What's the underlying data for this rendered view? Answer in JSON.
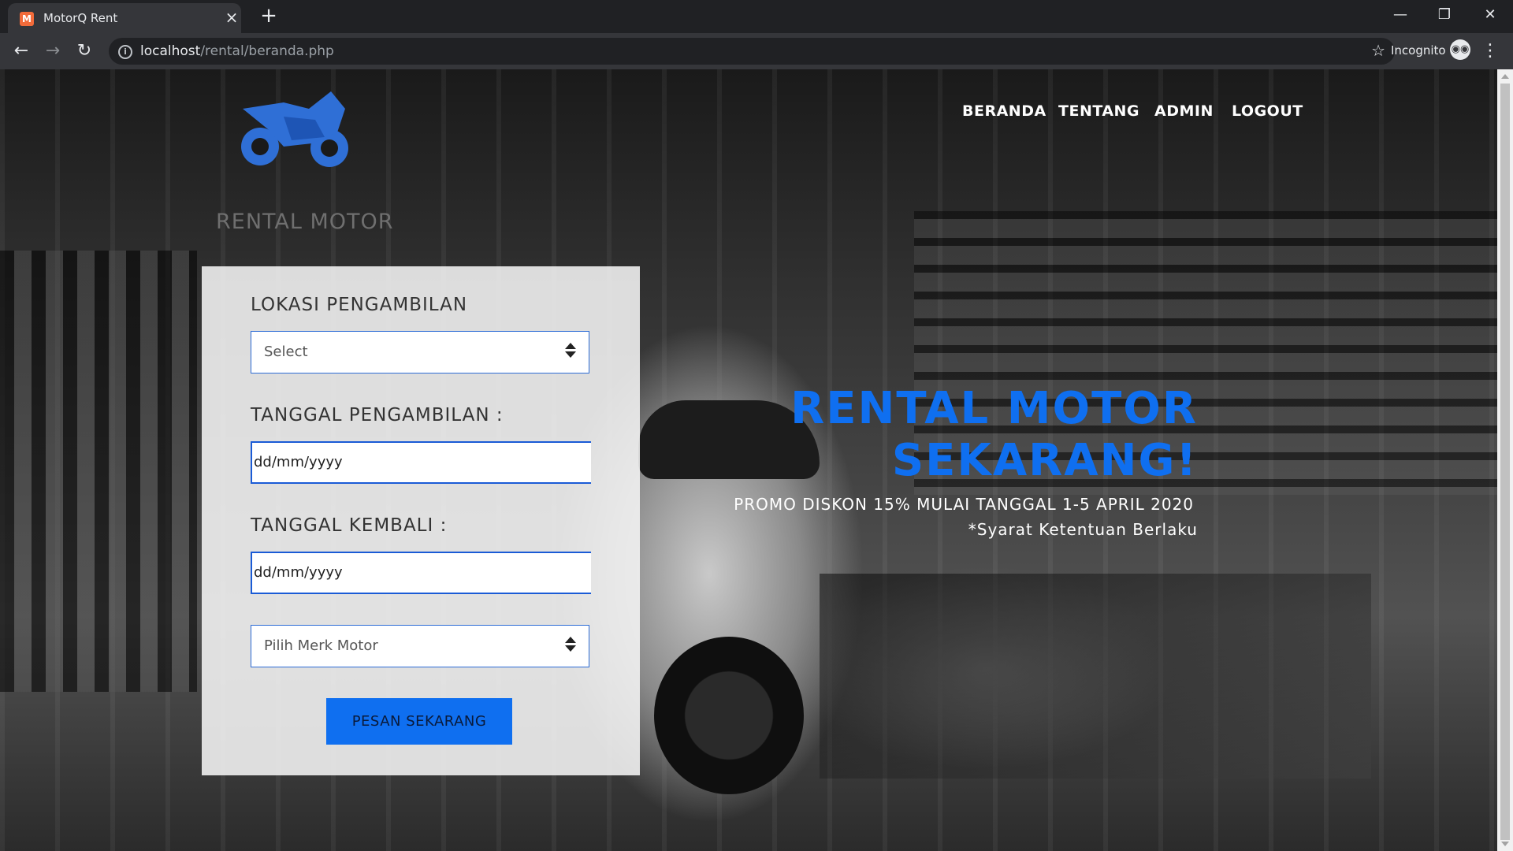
{
  "browser": {
    "tab_title": "MotorQ Rent",
    "tab_close": "×",
    "new_tab": "+",
    "favicon_letter": "M",
    "url_host": "localhost",
    "url_path": "/rental/beranda.php",
    "incognito_label": "Incognito",
    "window_controls": {
      "minimize": "—",
      "restore": "❐",
      "close": "✕"
    },
    "nav": {
      "back": "←",
      "forward": "→",
      "reload": "↻",
      "star": "☆",
      "menu": "⋮",
      "info": "i"
    }
  },
  "logo": {
    "text": "RENTAL MOTOR",
    "icon": "motorcycle-icon",
    "icon_color": "#2f6fd6"
  },
  "nav": {
    "items": [
      {
        "label": "BERANDA"
      },
      {
        "label": "TENTANG"
      },
      {
        "label": "ADMIN"
      },
      {
        "label": "LOGOUT"
      }
    ]
  },
  "form": {
    "pickup_location_label": "LOKASI PENGAMBILAN",
    "pickup_location_value": "Select",
    "pickup_date_label": "TANGGAL PENGAMBILAN :",
    "pickup_date_value": "dd/mm/yyyy",
    "return_date_label": "TANGGAL KEMBALI :",
    "return_date_value": "dd/mm/yyyy",
    "brand_value": "Pilih Merk Motor",
    "submit_label": "PESAN SEKARANG"
  },
  "hero": {
    "title_line1": "RENTAL MOTOR",
    "title_line2": "SEKARANG!",
    "promo": "PROMO DISKON 15% MULAI TANGGAL 1-5 APRIL 2020",
    "terms": "*Syarat Ketentuan Berlaku"
  },
  "colors": {
    "accent": "#0f6ff0",
    "chrome_dark": "#202124",
    "chrome_mid": "#35363a"
  }
}
